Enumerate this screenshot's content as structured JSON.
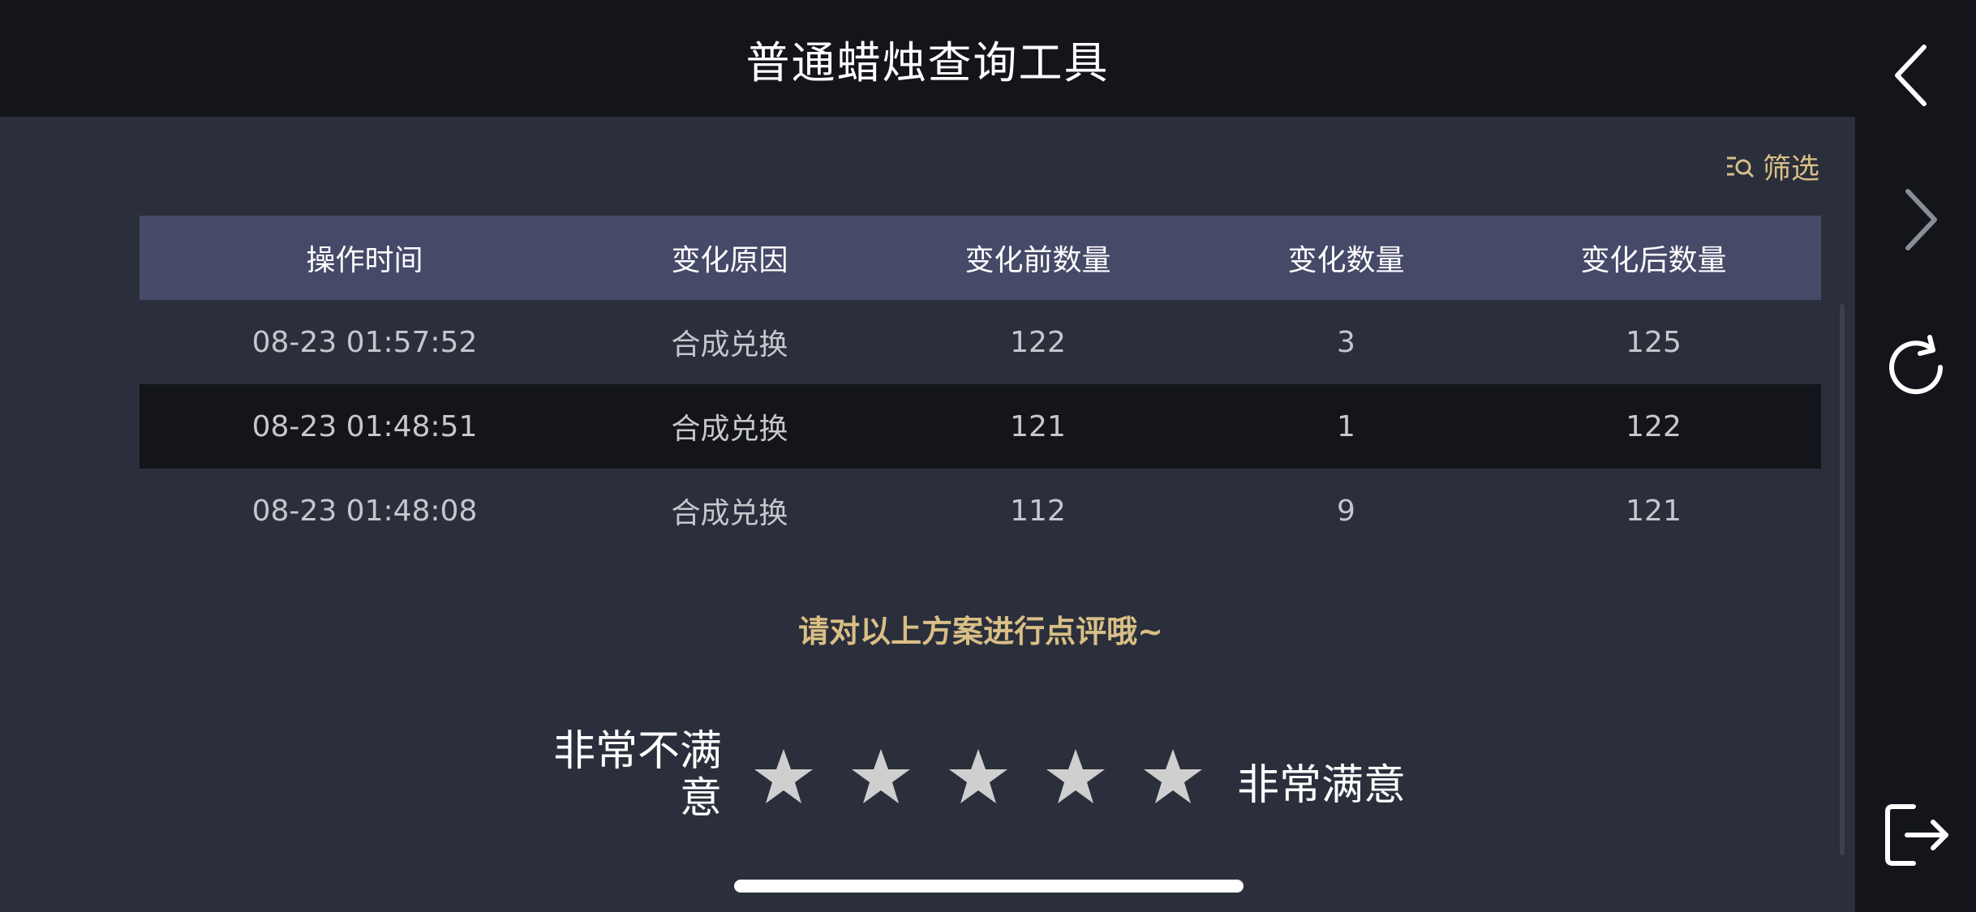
{
  "header": {
    "title": "普通蜡烛查询工具"
  },
  "filter": {
    "label": "筛选",
    "icon": "filter-search-icon"
  },
  "table": {
    "columns": [
      "操作时间",
      "变化原因",
      "变化前数量",
      "变化数量",
      "变化后数量"
    ],
    "rows": [
      [
        "08-23 01:57:52",
        "合成兑换",
        "122",
        "3",
        "125"
      ],
      [
        "08-23 01:48:51",
        "合成兑换",
        "121",
        "1",
        "122"
      ],
      [
        "08-23 01:48:08",
        "合成兑换",
        "112",
        "9",
        "121"
      ]
    ]
  },
  "rating": {
    "prompt": "请对以上方案进行点评哦~",
    "low_label_line1": "非常不满",
    "low_label_line2": "意",
    "high_label": "非常满意",
    "max_stars": 5,
    "selected": 0
  },
  "sidebar": {
    "items": [
      "back-icon",
      "forward-icon",
      "refresh-icon",
      "exit-icon"
    ]
  },
  "colors": {
    "accent": "#d9bf86",
    "header_bg": "#13151b",
    "table_head_bg": "#454a68",
    "body_bg": "#2b2f3b",
    "star": "#cfcfcf"
  }
}
